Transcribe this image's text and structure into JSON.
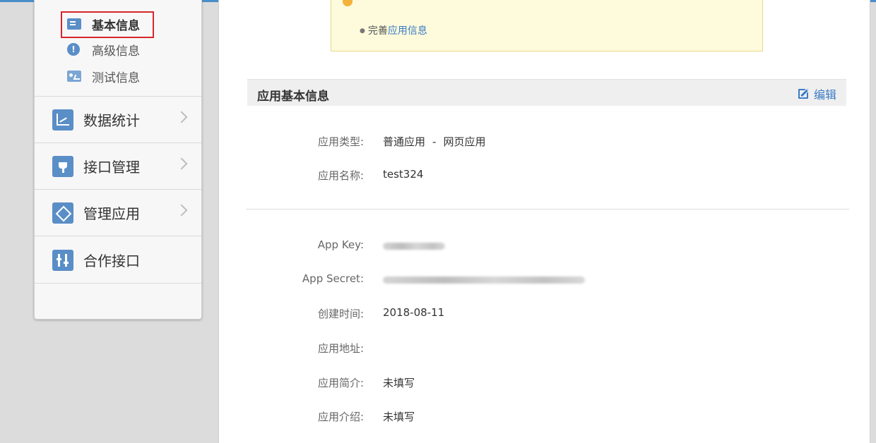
{
  "sidebar": {
    "sub_items": [
      {
        "label": "基本信息",
        "icon": "document-icon",
        "active": true
      },
      {
        "label": "高级信息",
        "icon": "info-icon"
      },
      {
        "label": "测试信息",
        "icon": "test-card-icon"
      }
    ],
    "menu": [
      {
        "label": "数据统计",
        "icon": "chart-icon"
      },
      {
        "label": "接口管理",
        "icon": "plug-icon"
      },
      {
        "label": "管理应用",
        "icon": "layers-icon"
      },
      {
        "label": "合作接口",
        "icon": "sliders-icon"
      }
    ],
    "info_icon_glyph": "!"
  },
  "notice": {
    "prefix": "完善",
    "link_text": "应用信息"
  },
  "section": {
    "title": "应用基本信息",
    "edit_label": "编辑"
  },
  "fields": {
    "app_type_label": "应用类型:",
    "app_type_main": "普通应用",
    "app_type_sep": "-",
    "app_type_sub": "网页应用",
    "app_name_label": "应用名称:",
    "app_name_value": "test324",
    "app_key_label": "App Key:",
    "app_secret_label": "App Secret:",
    "created_label": "创建时间:",
    "created_value": "2018-08-11",
    "url_label": "应用地址:",
    "url_value": "",
    "brief_label": "应用简介:",
    "brief_value": "未填写",
    "intro_label": "应用介绍:",
    "intro_value": "未填写"
  },
  "colors": {
    "accent": "#3b7bc4",
    "icon_blue": "#5a8ec7",
    "highlight_red": "#d8262a",
    "notice_bg": "#fdfbdc"
  }
}
